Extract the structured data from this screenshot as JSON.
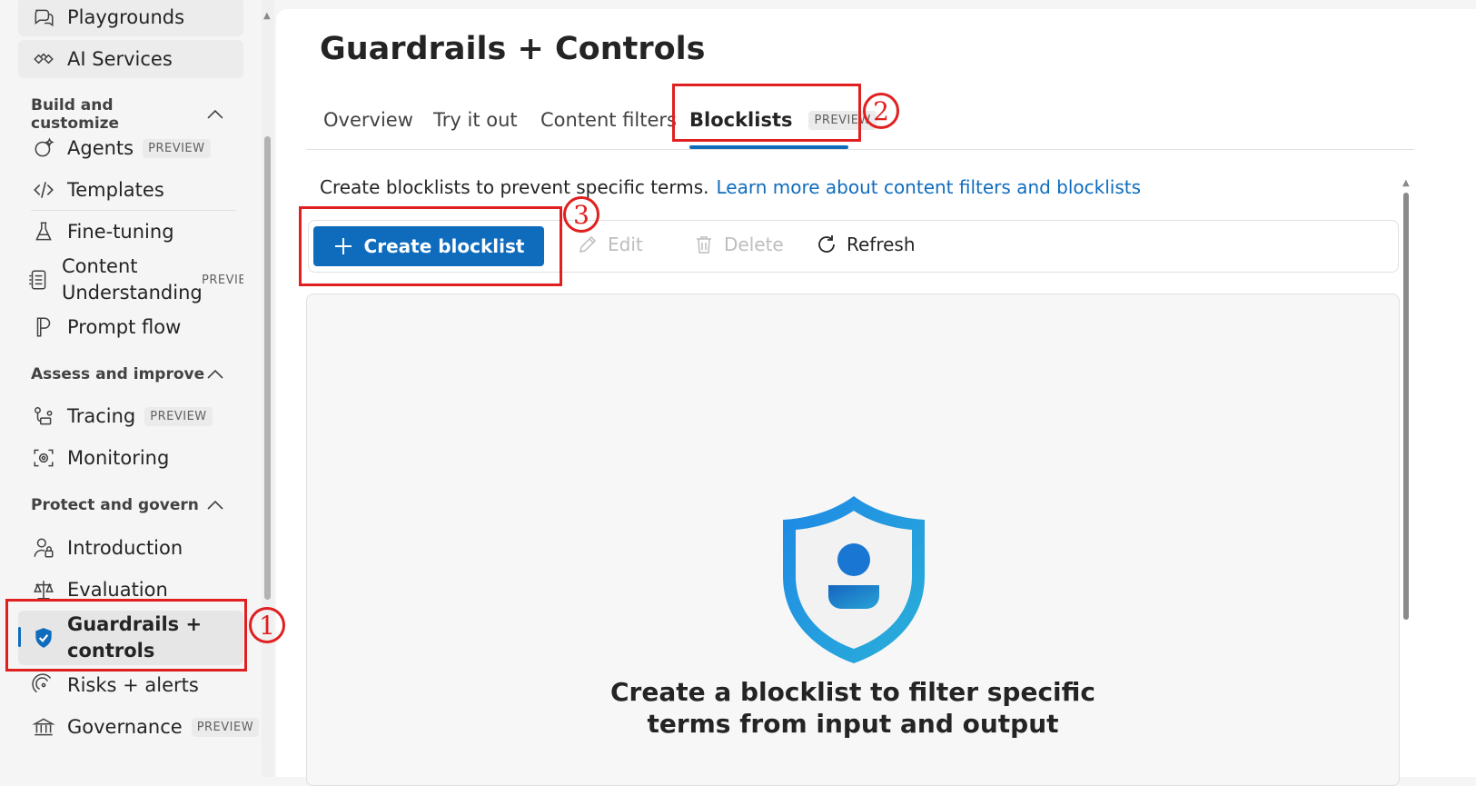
{
  "sidebar": {
    "top_items": [
      {
        "label": "Playgrounds",
        "icon": "chat-bubbles-icon"
      },
      {
        "label": "AI Services",
        "icon": "ai-services-icon"
      }
    ],
    "sections": [
      {
        "title": "Build and customize",
        "items": [
          {
            "label": "Agents",
            "badge": "PREVIEW"
          },
          {
            "label": "Templates"
          },
          {
            "label": "Fine-tuning"
          },
          {
            "label_line1": "Content",
            "label_line2": "Understanding",
            "badge": "PREVIEW"
          },
          {
            "label": "Prompt flow"
          }
        ]
      },
      {
        "title": "Assess and improve",
        "items": [
          {
            "label": "Tracing",
            "badge": "PREVIEW"
          },
          {
            "label": "Monitoring"
          }
        ]
      },
      {
        "title": "Protect and govern",
        "items": [
          {
            "label": "Introduction"
          },
          {
            "label": "Evaluation"
          },
          {
            "label_line1": "Guardrails +",
            "label_line2": "controls",
            "active": true
          },
          {
            "label": "Risks + alerts"
          },
          {
            "label": "Governance",
            "badge": "PREVIEW"
          }
        ]
      }
    ]
  },
  "main": {
    "title": "Guardrails + Controls",
    "tabs": [
      {
        "label": "Overview"
      },
      {
        "label": "Try it out"
      },
      {
        "label": "Content filters"
      },
      {
        "label": "Blocklists",
        "badge": "PREVIEW",
        "selected": true
      }
    ],
    "description": "Create blocklists to prevent specific terms.",
    "learn_more_link": "Learn more about content filters and blocklists",
    "toolbar": {
      "create": "Create blocklist",
      "edit": "Edit",
      "delete": "Delete",
      "refresh": "Refresh"
    },
    "empty_state": {
      "line1": "Create a blocklist to filter specific",
      "line2": "terms from input and output"
    }
  },
  "annotations": {
    "one": "1",
    "two": "2",
    "three": "3"
  },
  "colors": {
    "accent": "#0f6cbd",
    "annotation": "#e02020"
  }
}
